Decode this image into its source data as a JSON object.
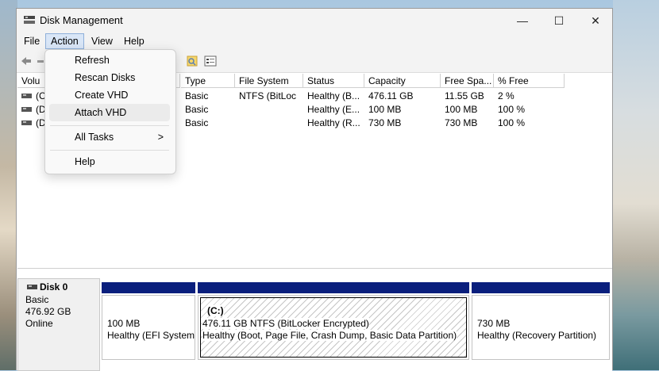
{
  "window": {
    "title": "Disk Management"
  },
  "controls": {
    "minimize": "—",
    "maximize": "☐",
    "close": "✕"
  },
  "menubar": [
    "File",
    "Action",
    "View",
    "Help"
  ],
  "action_menu": {
    "items": [
      "Refresh",
      "Rescan Disks",
      "Create VHD",
      "Attach VHD"
    ],
    "all_tasks": "All Tasks",
    "submenu_arrow": ">",
    "help": "Help",
    "hovered": "Attach VHD"
  },
  "volume_list": {
    "headers": [
      "Volu",
      "Type",
      "File System",
      "Status",
      "Capacity",
      "Free Spa...",
      "% Free"
    ],
    "rows": [
      {
        "volume": "(C",
        "type": "Basic",
        "fs": "NTFS (BitLoc",
        "status": "Healthy (B...",
        "capacity": "476.11 GB",
        "free": "11.55 GB",
        "pct": "2 %"
      },
      {
        "volume": "(Di",
        "type": "Basic",
        "fs": "",
        "status": "Healthy (E...",
        "capacity": "100 MB",
        "free": "100 MB",
        "pct": "100 %"
      },
      {
        "volume": "(Di",
        "type": "Basic",
        "fs": "",
        "status": "Healthy (R...",
        "capacity": "730 MB",
        "free": "730 MB",
        "pct": "100 %"
      }
    ]
  },
  "disk0": {
    "name": "Disk 0",
    "type": "Basic",
    "size": "476.92 GB",
    "state": "Online",
    "partitions": [
      {
        "size": "100 MB",
        "status": "Healthy (EFI System"
      },
      {
        "label": "(C:)",
        "size": "476.11 GB NTFS (BitLocker Encrypted)",
        "status": "Healthy (Boot, Page File, Crash Dump, Basic Data Partition)"
      },
      {
        "size": "730 MB",
        "status": "Healthy (Recovery Partition)"
      }
    ]
  },
  "colors": {
    "partition_header": "#0a1f7d",
    "menu_active": "#d9e6f7"
  }
}
